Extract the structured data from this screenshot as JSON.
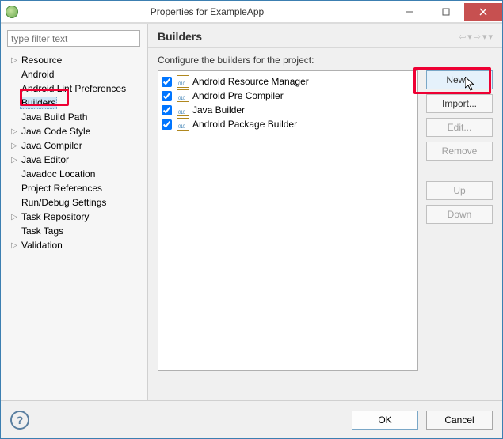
{
  "window": {
    "title": "Properties for ExampleApp"
  },
  "filter_placeholder": "type filter text",
  "tree": {
    "items": [
      {
        "label": "Resource",
        "expandable": true,
        "selected": false
      },
      {
        "label": "Android",
        "expandable": false,
        "selected": false
      },
      {
        "label": "Android Lint Preferences",
        "expandable": false,
        "selected": false
      },
      {
        "label": "Builders",
        "expandable": false,
        "selected": true
      },
      {
        "label": "Java Build Path",
        "expandable": false,
        "selected": false
      },
      {
        "label": "Java Code Style",
        "expandable": true,
        "selected": false
      },
      {
        "label": "Java Compiler",
        "expandable": true,
        "selected": false
      },
      {
        "label": "Java Editor",
        "expandable": true,
        "selected": false
      },
      {
        "label": "Javadoc Location",
        "expandable": false,
        "selected": false
      },
      {
        "label": "Project References",
        "expandable": false,
        "selected": false
      },
      {
        "label": "Run/Debug Settings",
        "expandable": false,
        "selected": false
      },
      {
        "label": "Task Repository",
        "expandable": true,
        "selected": false
      },
      {
        "label": "Task Tags",
        "expandable": false,
        "selected": false
      },
      {
        "label": "Validation",
        "expandable": true,
        "selected": false
      }
    ]
  },
  "page": {
    "title": "Builders",
    "description": "Configure the builders for the project:"
  },
  "builders": [
    {
      "label": "Android Resource Manager",
      "checked": true
    },
    {
      "label": "Android Pre Compiler",
      "checked": true
    },
    {
      "label": "Java Builder",
      "checked": true
    },
    {
      "label": "Android Package Builder",
      "checked": true
    }
  ],
  "buttons": {
    "new": "New...",
    "import": "Import...",
    "edit": "Edit...",
    "remove": "Remove",
    "up": "Up",
    "down": "Down",
    "ok": "OK",
    "cancel": "Cancel"
  }
}
